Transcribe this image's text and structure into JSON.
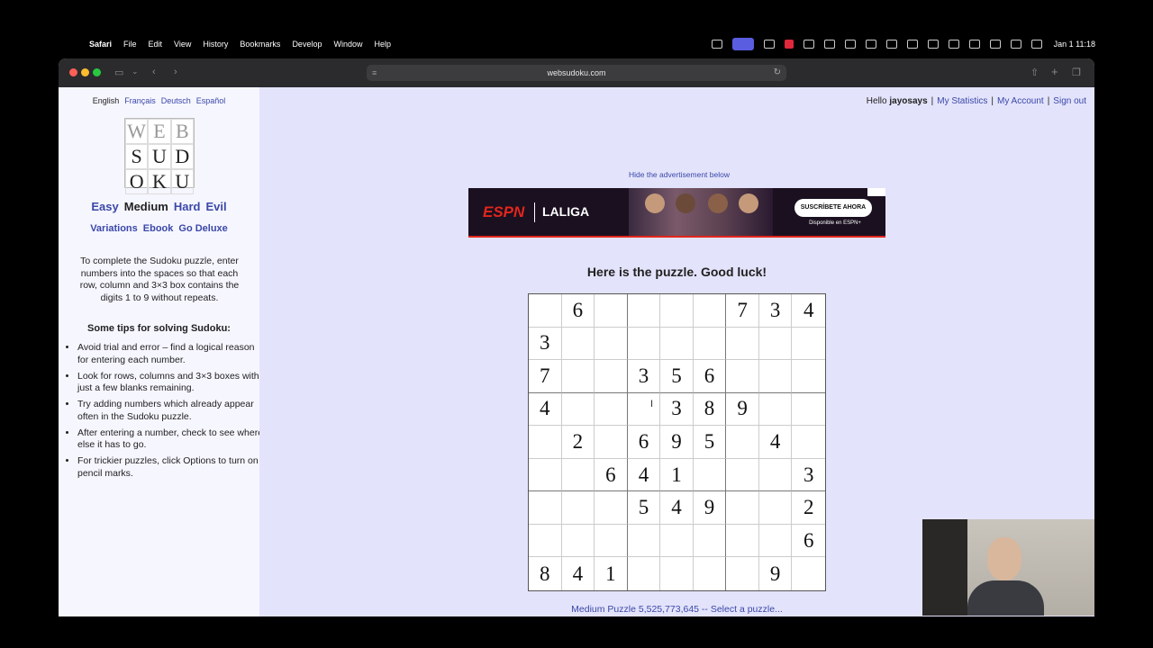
{
  "menubar": {
    "app": "Safari",
    "menus": [
      "File",
      "Edit",
      "View",
      "History",
      "Bookmarks",
      "Develop",
      "Window",
      "Help"
    ],
    "clock": "Jan 1  11:18"
  },
  "browser": {
    "url": "websudoku.com"
  },
  "sidebar": {
    "languages": [
      "English",
      "Français",
      "Deutsch",
      "Español"
    ],
    "logo": [
      "W",
      "E",
      "B",
      "S",
      "U",
      "D",
      "O",
      "K",
      "U"
    ],
    "levels": [
      "Easy",
      "Medium",
      "Hard",
      "Evil"
    ],
    "links": [
      "Variations",
      "Ebook",
      "Go Deluxe"
    ],
    "intro": "To complete the Sudoku puzzle, enter numbers into the spaces so that each row, column and 3×3 box contains the digits 1 to 9 without repeats.",
    "tips_heading": "Some tips for solving Sudoku:",
    "tips": [
      "Avoid trial and error – find a logical reason for entering each number.",
      "Look for rows, columns and 3×3 boxes with just a few blanks remaining.",
      "Try adding numbers which already appear often in the Sudoku puzzle.",
      "After entering a number, check to see where else it has to go.",
      "For trickier puzzles, click Options to turn on pencil marks."
    ]
  },
  "user": {
    "hello": "Hello ",
    "username": "jayosays",
    "links": [
      "My Statistics",
      "My Account",
      "Sign out"
    ]
  },
  "ad": {
    "hide_text": "Hide the advertisement below",
    "brand": "ESPN",
    "league": "LALIGA",
    "cta": "SUSCRÍBETE AHORA",
    "sub": "Disponible en ESPN+"
  },
  "puzzle": {
    "heading": "Here is the puzzle. Good luck!",
    "grid": [
      [
        "",
        "6",
        "",
        "",
        "",
        "",
        "7",
        "3",
        "4"
      ],
      [
        "3",
        "",
        "",
        "",
        "",
        "",
        "",
        "",
        ""
      ],
      [
        "7",
        "",
        "",
        "3",
        "5",
        "6",
        "",
        "",
        ""
      ],
      [
        "4",
        "",
        "",
        "",
        "3",
        "8",
        "9",
        "",
        ""
      ],
      [
        "",
        "2",
        "",
        "6",
        "9",
        "5",
        "",
        "4",
        ""
      ],
      [
        "",
        "",
        "6",
        "4",
        "1",
        "",
        "",
        "",
        "3"
      ],
      [
        "",
        "",
        "",
        "5",
        "4",
        "9",
        "",
        "",
        "2"
      ],
      [
        "",
        "",
        "",
        "",
        "",
        "",
        "",
        "",
        "6"
      ],
      [
        "8",
        "4",
        "1",
        "",
        "",
        "",
        "",
        "9",
        ""
      ]
    ],
    "footer": "Medium Puzzle 5,525,773,645 -- Select a puzzle..."
  }
}
